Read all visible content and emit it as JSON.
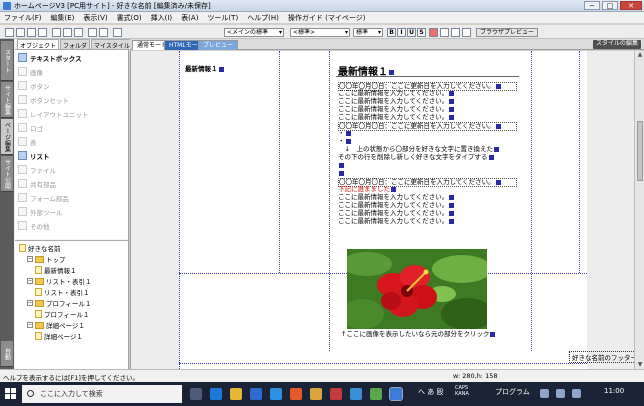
{
  "window": {
    "title": "ホームページV3 [PC用サイト] - 好きな名前 [編集済み/未保存]"
  },
  "window_buttons": {
    "minimize": "−",
    "maximize": "□",
    "close": "✕"
  },
  "menu": [
    "ファイル(F)",
    "編集(E)",
    "表示(V)",
    "書式(O)",
    "挿入(I)",
    "表(A)",
    "ツール(T)",
    "ヘルプ(H)",
    "操作ガイド (マイページ)"
  ],
  "toolbar": {
    "style_select": "<メインの標準",
    "font_select": "<標準>",
    "size_select": "標準",
    "format_buttons": [
      "B",
      "I",
      "U",
      "S"
    ],
    "browser_preview": "ブラウザプレビュー"
  },
  "leftpanel": {
    "vtabs": [
      "スタート",
      "サイト編集",
      "ページ編集",
      "サイト公開",
      "自動"
    ],
    "tabs": [
      "オブジェクト",
      "フォルダ",
      "マイスタイル"
    ],
    "parts": [
      {
        "label": "テキストボックス",
        "state": "bold"
      },
      {
        "label": "画像",
        "state": "dis"
      },
      {
        "label": "ボタン",
        "state": "dis"
      },
      {
        "label": "ボタンセット",
        "state": "dis"
      },
      {
        "label": "レイアウトユニット",
        "state": "dis"
      },
      {
        "label": "ロゴ",
        "state": "dis"
      },
      {
        "label": "表",
        "state": "dis"
      },
      {
        "label": "リスト",
        "state": "bold"
      },
      {
        "label": "ファイル",
        "state": "dis"
      },
      {
        "label": "共有部品",
        "state": "dis"
      },
      {
        "label": "フォーム部品",
        "state": "dis"
      },
      {
        "label": "外部ツール",
        "state": "dis"
      },
      {
        "label": "その他",
        "state": "dis"
      }
    ],
    "tree": [
      {
        "label": "好きな名前",
        "level": 0,
        "type": "doc",
        "toggle": ""
      },
      {
        "label": "トップ",
        "level": 1,
        "type": "fold",
        "toggle": "−"
      },
      {
        "label": "最新情報１",
        "level": 2,
        "type": "doc",
        "toggle": ""
      },
      {
        "label": "リスト・表引１",
        "level": 1,
        "type": "fold",
        "toggle": "−"
      },
      {
        "label": "リスト・表引１",
        "level": 2,
        "type": "doc",
        "toggle": ""
      },
      {
        "label": "プロフィール１",
        "level": 1,
        "type": "fold",
        "toggle": "−"
      },
      {
        "label": "プロフィール１",
        "level": 2,
        "type": "doc",
        "toggle": ""
      },
      {
        "label": "詳細ページ１",
        "level": 1,
        "type": "fold",
        "toggle": "−"
      },
      {
        "label": "詳細ページ１",
        "level": 2,
        "type": "doc",
        "toggle": ""
      }
    ]
  },
  "editor": {
    "tabs": [
      "通常モード",
      "HTMLモード",
      "プレビュー"
    ],
    "style_button": "スタイルの編集",
    "side_heading": "最新情報１",
    "heading": "最新情報１",
    "lines": [
      {
        "text": "〇〇年〇月〇日：ここに更新日を入力してください。",
        "cls": "box"
      },
      {
        "text": "ここに最新情報を入力してください。",
        "cls": ""
      },
      {
        "text": "ここに最新情報を入力してください。",
        "cls": ""
      },
      {
        "text": "ここに最新情報を入力してください。",
        "cls": ""
      },
      {
        "text": "ここに最新情報を入力してください。",
        "cls": ""
      },
      {
        "text": "〇〇年〇月〇日：ここに更新日を入力してください。",
        "cls": "box"
      },
      {
        "text": "・",
        "cls": ""
      },
      {
        "text": "・",
        "cls": ""
      },
      {
        "text": "　↓　上の状態から〇部分を好きな文字に置き換えた",
        "cls": ""
      },
      {
        "text": "その下の行を削除し新しく好きな文字をタイプする",
        "cls": ""
      },
      {
        "text": "",
        "cls": ""
      },
      {
        "text": "",
        "cls": ""
      },
      {
        "text": "〇〇年〇月〇日：ここに更新日を入力してください。",
        "cls": "box"
      },
      {
        "text": "下記に誰まました",
        "cls": "red"
      },
      {
        "text": "ここに最新情報を入力してください。",
        "cls": ""
      },
      {
        "text": "ここに最新情報を入力してください。",
        "cls": ""
      },
      {
        "text": "ここに最新情報を入力してください。",
        "cls": ""
      },
      {
        "text": "ここに最新情報を入力してください。",
        "cls": ""
      }
    ],
    "caption": "↑ここに画像を表示したいなら元の部分をクリック",
    "footer_button": "好きな名前のフッター"
  },
  "status": {
    "help": "ヘルプを表示するには[F1]を押してください。",
    "position": "w: 280,h: 158"
  },
  "taskbar": {
    "search_placeholder": "ここに入力して検索",
    "tray_text": "へ あ 殴",
    "ime": "CAPS KANA",
    "program_label": "プログラム",
    "clock": "11:00"
  }
}
